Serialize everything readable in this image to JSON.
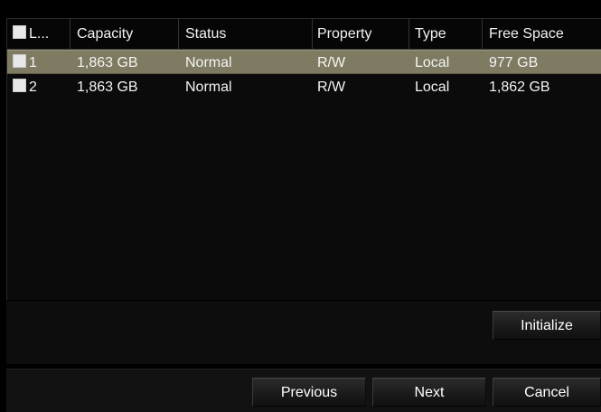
{
  "table": {
    "columns": [
      "L...",
      "Capacity",
      "Status",
      "Property",
      "Type",
      "Free Space"
    ],
    "rows": [
      {
        "label": "1",
        "capacity": "1,863 GB",
        "status": "Normal",
        "property": "R/W",
        "type": "Local",
        "free_space": "977 GB",
        "selected": true
      },
      {
        "label": "2",
        "capacity": "1,863 GB",
        "status": "Normal",
        "property": "R/W",
        "type": "Local",
        "free_space": "1,862 GB",
        "selected": false
      }
    ]
  },
  "buttons": {
    "initialize": "Initialize",
    "previous": "Previous",
    "next": "Next",
    "cancel": "Cancel"
  },
  "colors": {
    "selected_row": "#7f7b62",
    "background": "#000000"
  }
}
